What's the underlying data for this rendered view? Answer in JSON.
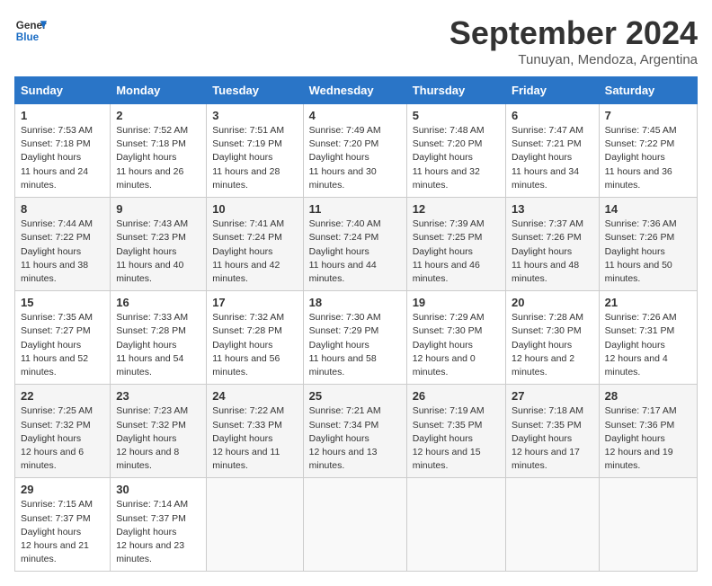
{
  "logo": {
    "line1": "General",
    "line2": "Blue"
  },
  "title": "September 2024",
  "location": "Tunuyan, Mendoza, Argentina",
  "weekdays": [
    "Sunday",
    "Monday",
    "Tuesday",
    "Wednesday",
    "Thursday",
    "Friday",
    "Saturday"
  ],
  "weeks": [
    [
      {
        "day": "1",
        "sunrise": "7:53 AM",
        "sunset": "7:18 PM",
        "daylight": "11 hours and 24 minutes."
      },
      {
        "day": "2",
        "sunrise": "7:52 AM",
        "sunset": "7:18 PM",
        "daylight": "11 hours and 26 minutes."
      },
      {
        "day": "3",
        "sunrise": "7:51 AM",
        "sunset": "7:19 PM",
        "daylight": "11 hours and 28 minutes."
      },
      {
        "day": "4",
        "sunrise": "7:49 AM",
        "sunset": "7:20 PM",
        "daylight": "11 hours and 30 minutes."
      },
      {
        "day": "5",
        "sunrise": "7:48 AM",
        "sunset": "7:20 PM",
        "daylight": "11 hours and 32 minutes."
      },
      {
        "day": "6",
        "sunrise": "7:47 AM",
        "sunset": "7:21 PM",
        "daylight": "11 hours and 34 minutes."
      },
      {
        "day": "7",
        "sunrise": "7:45 AM",
        "sunset": "7:22 PM",
        "daylight": "11 hours and 36 minutes."
      }
    ],
    [
      {
        "day": "8",
        "sunrise": "7:44 AM",
        "sunset": "7:22 PM",
        "daylight": "11 hours and 38 minutes."
      },
      {
        "day": "9",
        "sunrise": "7:43 AM",
        "sunset": "7:23 PM",
        "daylight": "11 hours and 40 minutes."
      },
      {
        "day": "10",
        "sunrise": "7:41 AM",
        "sunset": "7:24 PM",
        "daylight": "11 hours and 42 minutes."
      },
      {
        "day": "11",
        "sunrise": "7:40 AM",
        "sunset": "7:24 PM",
        "daylight": "11 hours and 44 minutes."
      },
      {
        "day": "12",
        "sunrise": "7:39 AM",
        "sunset": "7:25 PM",
        "daylight": "11 hours and 46 minutes."
      },
      {
        "day": "13",
        "sunrise": "7:37 AM",
        "sunset": "7:26 PM",
        "daylight": "11 hours and 48 minutes."
      },
      {
        "day": "14",
        "sunrise": "7:36 AM",
        "sunset": "7:26 PM",
        "daylight": "11 hours and 50 minutes."
      }
    ],
    [
      {
        "day": "15",
        "sunrise": "7:35 AM",
        "sunset": "7:27 PM",
        "daylight": "11 hours and 52 minutes."
      },
      {
        "day": "16",
        "sunrise": "7:33 AM",
        "sunset": "7:28 PM",
        "daylight": "11 hours and 54 minutes."
      },
      {
        "day": "17",
        "sunrise": "7:32 AM",
        "sunset": "7:28 PM",
        "daylight": "11 hours and 56 minutes."
      },
      {
        "day": "18",
        "sunrise": "7:30 AM",
        "sunset": "7:29 PM",
        "daylight": "11 hours and 58 minutes."
      },
      {
        "day": "19",
        "sunrise": "7:29 AM",
        "sunset": "7:30 PM",
        "daylight": "12 hours and 0 minutes."
      },
      {
        "day": "20",
        "sunrise": "7:28 AM",
        "sunset": "7:30 PM",
        "daylight": "12 hours and 2 minutes."
      },
      {
        "day": "21",
        "sunrise": "7:26 AM",
        "sunset": "7:31 PM",
        "daylight": "12 hours and 4 minutes."
      }
    ],
    [
      {
        "day": "22",
        "sunrise": "7:25 AM",
        "sunset": "7:32 PM",
        "daylight": "12 hours and 6 minutes."
      },
      {
        "day": "23",
        "sunrise": "7:23 AM",
        "sunset": "7:32 PM",
        "daylight": "12 hours and 8 minutes."
      },
      {
        "day": "24",
        "sunrise": "7:22 AM",
        "sunset": "7:33 PM",
        "daylight": "12 hours and 11 minutes."
      },
      {
        "day": "25",
        "sunrise": "7:21 AM",
        "sunset": "7:34 PM",
        "daylight": "12 hours and 13 minutes."
      },
      {
        "day": "26",
        "sunrise": "7:19 AM",
        "sunset": "7:35 PM",
        "daylight": "12 hours and 15 minutes."
      },
      {
        "day": "27",
        "sunrise": "7:18 AM",
        "sunset": "7:35 PM",
        "daylight": "12 hours and 17 minutes."
      },
      {
        "day": "28",
        "sunrise": "7:17 AM",
        "sunset": "7:36 PM",
        "daylight": "12 hours and 19 minutes."
      }
    ],
    [
      {
        "day": "29",
        "sunrise": "7:15 AM",
        "sunset": "7:37 PM",
        "daylight": "12 hours and 21 minutes."
      },
      {
        "day": "30",
        "sunrise": "7:14 AM",
        "sunset": "7:37 PM",
        "daylight": "12 hours and 23 minutes."
      },
      null,
      null,
      null,
      null,
      null
    ]
  ]
}
